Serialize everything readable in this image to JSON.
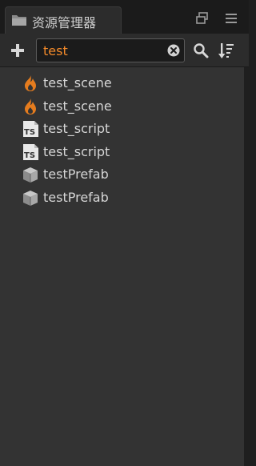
{
  "panel": {
    "title": "资源管理器",
    "title_icon": "folder-icon"
  },
  "window_controls": [
    {
      "icon": "popout-icon"
    },
    {
      "icon": "menu-icon"
    }
  ],
  "toolbar": {
    "add_icon": "plus-icon",
    "search": {
      "value": "test",
      "clear_icon": "clear-icon"
    },
    "search_icon": "search-icon",
    "sort_icon": "sort-icon"
  },
  "results": [
    {
      "label": "test_scene",
      "type": "scene",
      "icon": "scene-flame-icon"
    },
    {
      "label": "test_scene",
      "type": "scene",
      "icon": "scene-flame-icon"
    },
    {
      "label": "test_script",
      "type": "typescript",
      "icon": "typescript-icon"
    },
    {
      "label": "test_script",
      "type": "typescript",
      "icon": "typescript-icon"
    },
    {
      "label": "testPrefab",
      "type": "prefab",
      "icon": "prefab-icon"
    },
    {
      "label": "testPrefab",
      "type": "prefab",
      "icon": "prefab-icon"
    }
  ],
  "colors": {
    "search_text": "#f38a2a",
    "scene_icon": "#e57c1e",
    "label_text": "#d6d6d6",
    "panel_bg": "#333333"
  }
}
